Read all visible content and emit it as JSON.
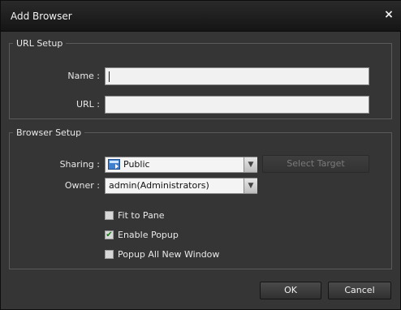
{
  "dialog": {
    "title": "Add Browser",
    "close_glyph": "×"
  },
  "url_setup": {
    "legend": "URL Setup",
    "name_label": "Name :",
    "name_value": "",
    "url_label": "URL :",
    "url_value": ""
  },
  "browser_setup": {
    "legend": "Browser Setup",
    "sharing_label": "Sharing :",
    "sharing_value": "Public",
    "sharing_icon": "computer-icon",
    "select_target_label": "Select Target",
    "owner_label": "Owner :",
    "owner_value": "admin(Administrators)",
    "options": [
      {
        "label": "Fit to Pane",
        "checked": false,
        "mark": ""
      },
      {
        "label": "Enable Popup",
        "checked": true,
        "mark": "✔"
      },
      {
        "label": "Popup All New Window",
        "checked": false,
        "mark": ""
      }
    ]
  },
  "buttons": {
    "ok_label": "OK",
    "cancel_label": "Cancel"
  },
  "colors": {
    "window_bg": "#353535",
    "titlebar_bg": "#151515",
    "text": "#e8e8e8",
    "check_mark": "#1c7a1c"
  }
}
